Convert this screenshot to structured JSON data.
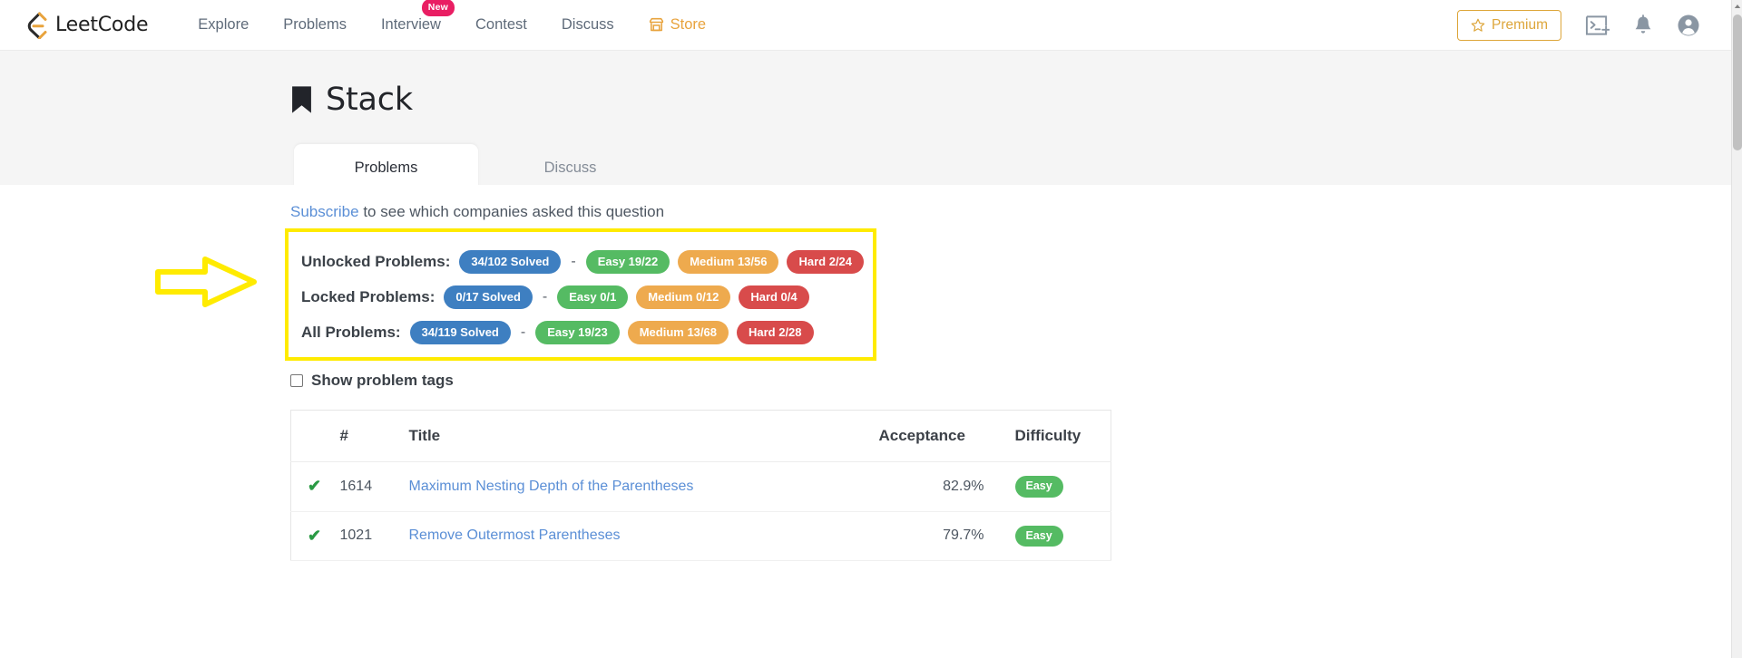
{
  "navbar": {
    "brand": "LeetCode",
    "links": [
      {
        "label": "Explore",
        "name": "nav-link-explore"
      },
      {
        "label": "Problems",
        "name": "nav-link-problems"
      },
      {
        "label": "Interview",
        "name": "nav-link-interview",
        "badge": "New"
      },
      {
        "label": "Contest",
        "name": "nav-link-contest"
      },
      {
        "label": "Discuss",
        "name": "nav-link-discuss"
      },
      {
        "label": "Store",
        "name": "nav-link-store"
      }
    ],
    "premium_label": "Premium",
    "icons": [
      "playground-icon",
      "bell-icon",
      "avatar-icon"
    ]
  },
  "hero": {
    "title": "Stack",
    "tabs": [
      {
        "label": "Problems",
        "active": true
      },
      {
        "label": "Discuss",
        "active": false
      }
    ]
  },
  "subscribe": {
    "link_text": "Subscribe",
    "rest_text": " to see which companies asked this question"
  },
  "stats": {
    "rows": [
      {
        "label": "Unlocked Problems:",
        "total": "34/102 Solved",
        "dash": "-",
        "easy": "Easy 19/22",
        "medium": "Medium 13/56",
        "hard": "Hard 2/24"
      },
      {
        "label": "Locked Problems:",
        "total": "0/17 Solved",
        "dash": "-",
        "easy": "Easy 0/1",
        "medium": "Medium 0/12",
        "hard": "Hard 0/4"
      },
      {
        "label": "All Problems:",
        "total": "34/119 Solved",
        "dash": "-",
        "easy": "Easy 19/23",
        "medium": "Medium 13/68",
        "hard": "Hard 2/28"
      }
    ],
    "highlight_color": "#ffeb00"
  },
  "show_tags": {
    "label": "Show problem tags",
    "checked": false
  },
  "table": {
    "headers": {
      "status": "",
      "number": "#",
      "title": "Title",
      "acceptance": "Acceptance",
      "difficulty": "Difficulty"
    },
    "rows": [
      {
        "status": "✔",
        "number": "1614",
        "title": "Maximum Nesting Depth of the Parentheses",
        "acceptance": "82.9%",
        "difficulty": "Easy"
      },
      {
        "status": "✔",
        "number": "1021",
        "title": "Remove Outermost Parentheses",
        "acceptance": "79.7%",
        "difficulty": "Easy"
      }
    ]
  },
  "colors": {
    "easy": "#55bb63",
    "medium": "#eeaa4e",
    "hard": "#d84b4b",
    "total": "#3e7fc1",
    "link": "#5b8fd6",
    "premium": "#dda63b"
  }
}
